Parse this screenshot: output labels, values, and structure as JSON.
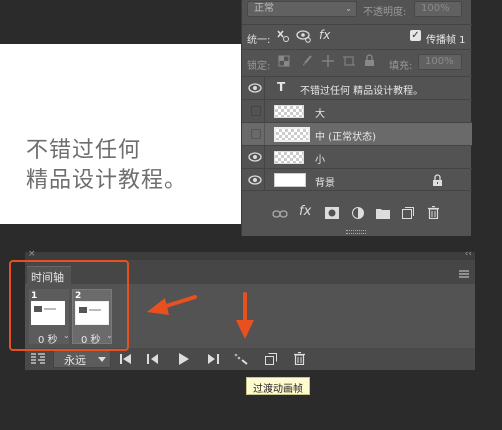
{
  "canvas": {
    "line1": "不错过任何",
    "line2": "精品设计教程。"
  },
  "layers_panel": {
    "blend_mode": "正常",
    "opacity_label": "不透明度:",
    "opacity_value": "100%",
    "unify_label": "统一:",
    "propagate_label": "传播帧 1",
    "lock_label": "锁定:",
    "fill_label": "填充:",
    "fill_value": "100%",
    "layers": [
      {
        "name": "不错过任何 精品设计教程。",
        "visible": true,
        "type": "text"
      },
      {
        "name": "大",
        "visible": false,
        "type": "image"
      },
      {
        "name": "中 (正常状态)",
        "visible": false,
        "type": "image",
        "selected": true
      },
      {
        "name": "小",
        "visible": true,
        "type": "image"
      },
      {
        "name": "背景",
        "visible": true,
        "type": "background",
        "locked": true
      }
    ]
  },
  "timeline": {
    "tab_label": "时间轴",
    "frames": [
      {
        "number": "1",
        "delay": "0 秒"
      },
      {
        "number": "2",
        "delay": "0 秒"
      }
    ],
    "loop_label": "永远",
    "tooltip": "过渡动画帧"
  },
  "colors": {
    "annotation": "#e8501f",
    "panel": "#535353",
    "background": "#2b2b2b"
  }
}
